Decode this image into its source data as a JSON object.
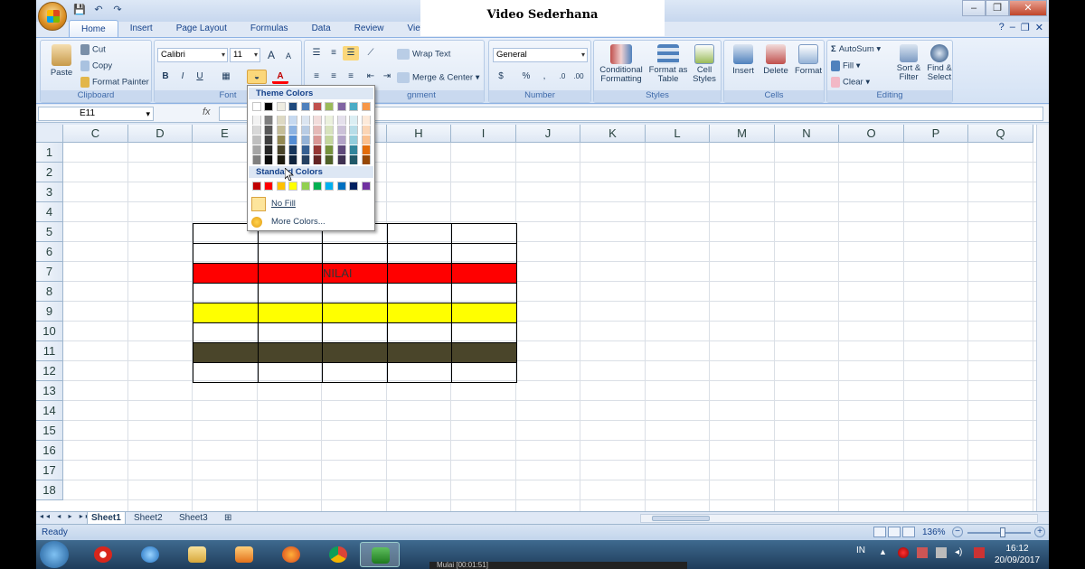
{
  "overlay_title": "Video Sederhana",
  "qat": {
    "save_icon": "💾",
    "undo_icon": "↶",
    "redo_icon": "↷"
  },
  "window_controls": {
    "minimize": "–",
    "restore": "❐",
    "close": "✕"
  },
  "tabs": [
    "Home",
    "Insert",
    "Page Layout",
    "Formulas",
    "Data",
    "Review",
    "View"
  ],
  "ribbon": {
    "clipboard": {
      "label": "Clipboard",
      "paste": "Paste",
      "cut": "Cut",
      "copy": "Copy",
      "format_painter": "Format Painter"
    },
    "font": {
      "label": "Font",
      "font_name": "Calibri",
      "font_size": "11",
      "bold": "B",
      "italic": "I",
      "underline": "U",
      "grow": "A",
      "shrink": "A"
    },
    "alignment": {
      "label": "Alignment",
      "label_visible": "gnment",
      "wrap_text": "Wrap Text",
      "merge_center": "Merge & Center"
    },
    "number": {
      "label": "Number",
      "format": "General",
      "percent": "%",
      "comma": ","
    },
    "styles": {
      "label": "Styles",
      "conditional": "Conditional Formatting",
      "format_table": "Format as Table",
      "cell_styles": "Cell Styles"
    },
    "cells": {
      "label": "Cells",
      "insert": "Insert",
      "delete": "Delete",
      "format": "Format"
    },
    "editing": {
      "label": "Editing",
      "autosum": "AutoSum",
      "fill": "Fill",
      "clear": "Clear",
      "sort_filter": "Sort & Filter",
      "find_select": "Find & Select"
    }
  },
  "formula_bar": {
    "name_box": "E11",
    "fx": "fx",
    "value": ""
  },
  "columns": [
    "C",
    "D",
    "E",
    "F",
    "G",
    "H",
    "I",
    "J",
    "K",
    "L",
    "M",
    "N",
    "O",
    "P",
    "Q"
  ],
  "rows": [
    "1",
    "2",
    "3",
    "4",
    "5",
    "6",
    "7",
    "8",
    "9",
    "10",
    "11",
    "12",
    "13",
    "14",
    "15",
    "16",
    "17",
    "18"
  ],
  "cells": {
    "row7_text": "NILAI"
  },
  "fills": {
    "row7": "#ff0000",
    "row9": "#ffff00",
    "row11": "#4a452a"
  },
  "palette": {
    "theme_label": "Theme Colors",
    "standard_label": "Standard Colors",
    "no_fill": "No Fill",
    "more_colors": "More Colors...",
    "theme_top": [
      "#ffffff",
      "#000000",
      "#eeece1",
      "#1f497d",
      "#4f81bd",
      "#c0504d",
      "#9bbb59",
      "#8064a2",
      "#4bacc6",
      "#f79646"
    ],
    "theme_shades": [
      [
        "#f2f2f2",
        "#d8d8d8",
        "#bfbfbf",
        "#a5a5a5",
        "#7f7f7f"
      ],
      [
        "#7f7f7f",
        "#595959",
        "#3f3f3f",
        "#262626",
        "#0c0c0c"
      ],
      [
        "#ddd9c3",
        "#c4bd97",
        "#938953",
        "#494429",
        "#1d1b10"
      ],
      [
        "#c6d9f0",
        "#8db3e2",
        "#548dd4",
        "#17365d",
        "#0f243e"
      ],
      [
        "#dbe5f1",
        "#b8cce4",
        "#95b3d7",
        "#366092",
        "#244061"
      ],
      [
        "#f2dcdb",
        "#e5b9b7",
        "#d99694",
        "#953734",
        "#632423"
      ],
      [
        "#ebf1dd",
        "#d7e3bc",
        "#c3d69b",
        "#76923c",
        "#4f6128"
      ],
      [
        "#e5e0ec",
        "#ccc1d9",
        "#b2a2c7",
        "#5f497a",
        "#3f3151"
      ],
      [
        "#dbeef3",
        "#b7dde8",
        "#92cddc",
        "#31859b",
        "#205867"
      ],
      [
        "#fdeada",
        "#fbd5b5",
        "#fac08f",
        "#e36c09",
        "#974806"
      ]
    ],
    "standard": [
      "#c00000",
      "#ff0000",
      "#ffc000",
      "#ffff00",
      "#92d050",
      "#00b050",
      "#00b0f0",
      "#0070c0",
      "#002060",
      "#7030a0"
    ]
  },
  "sheets": [
    "Sheet1",
    "Sheet2",
    "Sheet3"
  ],
  "status": {
    "text": "Ready",
    "zoom": "136%",
    "minus": "−",
    "plus": "+"
  },
  "taskbar": {
    "lang": "IN",
    "time": "16:12",
    "date": "20/09/2017",
    "recorder_text": "Mulai   [00:01:51]"
  }
}
